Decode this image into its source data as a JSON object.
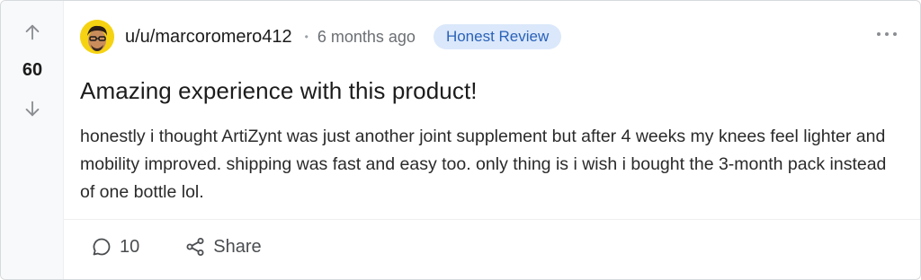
{
  "post": {
    "votes": "60",
    "author": "u/u/marcoromero412",
    "separator": "•",
    "time": "6 months ago",
    "flair": "Honest Review",
    "title": "Amazing experience with this product!",
    "body": "honestly i thought ArtiZynt was just another joint supplement but after 4 weeks my knees feel lighter and mobility improved. shipping was fast and easy too. only thing is i wish i bought the 3-month pack instead of one bottle lol.",
    "comments_count": "10",
    "share_label": "Share"
  },
  "icons": {
    "upvote": "arrow-up-icon",
    "downvote": "arrow-down-icon",
    "more": "more-options-icon",
    "comment": "comment-icon",
    "share": "share-icon"
  },
  "colors": {
    "flair_bg": "#dbe8fb",
    "flair_text": "#2b62b8",
    "avatar_bg": "#f5d312"
  }
}
